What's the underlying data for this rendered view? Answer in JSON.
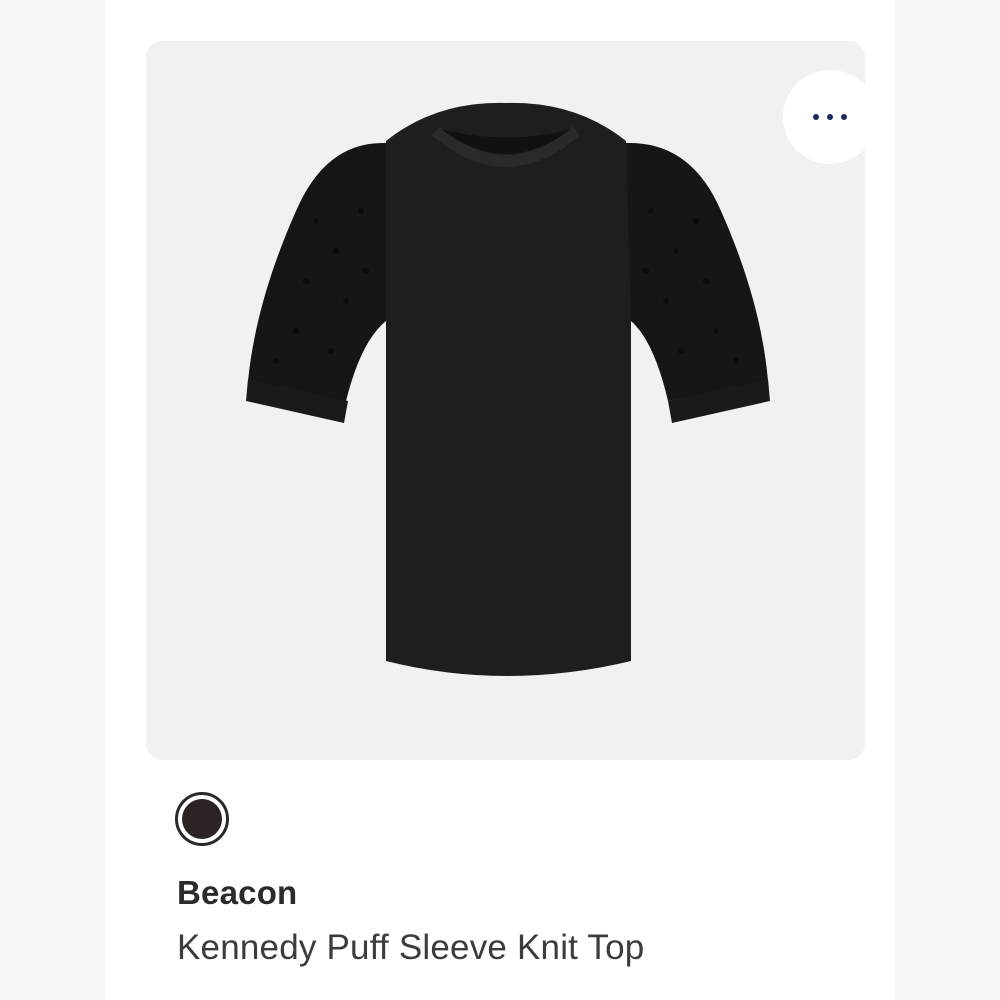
{
  "product": {
    "brand": "Beacon",
    "name": "Kennedy Puff Sleeve Knit Top",
    "image_icon": "black-puff-sleeve-tshirt-image"
  },
  "more_button": {
    "icon": "more-horizontal-icon",
    "dot_color": "#1f2a5c"
  },
  "swatches": [
    {
      "color": "#2b2222",
      "selected": true
    }
  ],
  "colors": {
    "panel_background": "#f0f1f3",
    "brand_text": "#2b2b2b",
    "name_text": "#3c3c3c"
  }
}
